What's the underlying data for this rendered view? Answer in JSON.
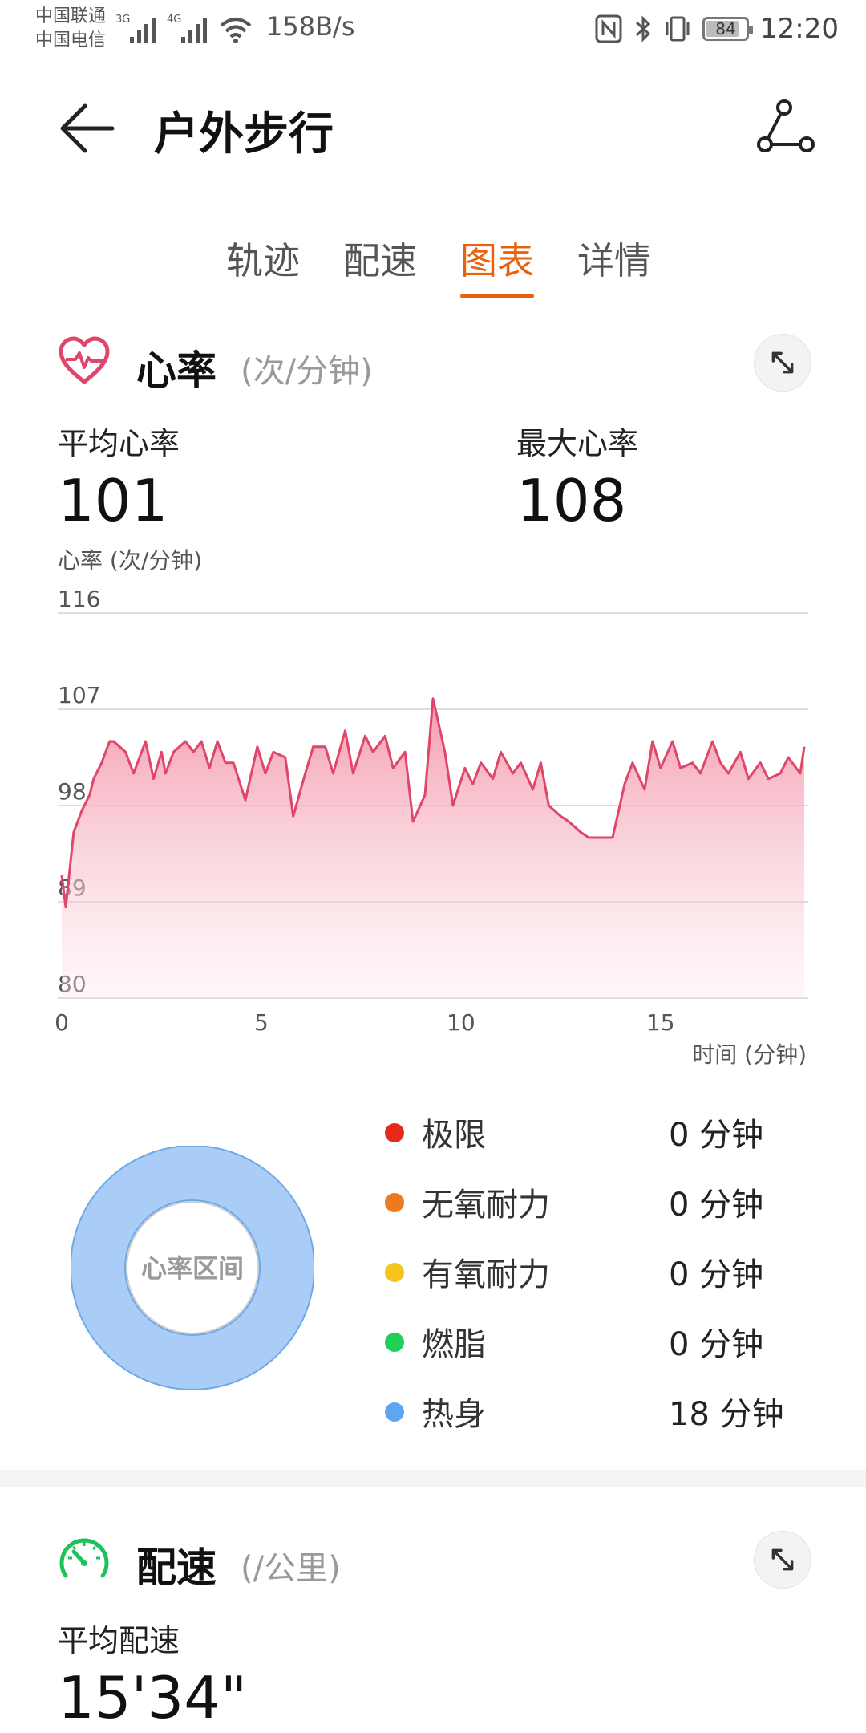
{
  "status_bar": {
    "carrier1": "中国联通",
    "carrier2": "中国电信",
    "sig1_tag": "3G",
    "sig2_tag": "4G",
    "net_speed": "158B/s",
    "battery": "84",
    "battery_level": 0.84,
    "time": "12:20"
  },
  "header": {
    "title": "户外步行"
  },
  "tabs": [
    {
      "label": "轨迹"
    },
    {
      "label": "配速"
    },
    {
      "label": "图表",
      "active": true
    },
    {
      "label": "详情"
    }
  ],
  "heart_rate": {
    "title": "心率",
    "unit": "(次/分钟)",
    "avg_label": "平均心率",
    "avg_value": "101",
    "max_label": "最大心率",
    "max_value": "108"
  },
  "chart_data": {
    "type": "area",
    "ylabel": "心率 (次/分钟)",
    "xlabel": "时间 (分钟)",
    "ylim": [
      80,
      116
    ],
    "yticks": [
      "116",
      "107",
      "98",
      "89",
      "80"
    ],
    "xlim": [
      -0.1,
      18.7
    ],
    "xticks": [
      "0",
      "5",
      "10",
      "15"
    ],
    "xtick_values": [
      0,
      5,
      10,
      15
    ],
    "color": "#e0466a",
    "x": [
      0,
      0.1,
      0.3,
      0.5,
      0.7,
      0.8,
      1.0,
      1.2,
      1.3,
      1.6,
      1.8,
      2.1,
      2.3,
      2.5,
      2.6,
      2.8,
      3.1,
      3.3,
      3.5,
      3.7,
      3.9,
      4.1,
      4.3,
      4.6,
      4.9,
      5.1,
      5.3,
      5.6,
      5.8,
      6.1,
      6.3,
      6.6,
      6.8,
      7.1,
      7.3,
      7.6,
      7.8,
      8.1,
      8.3,
      8.6,
      8.8,
      9.1,
      9.3,
      9.6,
      9.8,
      10.1,
      10.3,
      10.5,
      10.8,
      11.0,
      11.3,
      11.5,
      11.8,
      12.0,
      12.2,
      12.5,
      12.7,
      13.0,
      13.2,
      13.4,
      13.6,
      13.8,
      14.1,
      14.3,
      14.6,
      14.8,
      15.0,
      15.3,
      15.5,
      15.8,
      16.0,
      16.3,
      16.5,
      16.7,
      17.0,
      17.2,
      17.5,
      17.7,
      18.0,
      18.2,
      18.5,
      18.6
    ],
    "y": [
      91.5,
      88.5,
      95.5,
      97.5,
      99.0,
      100.5,
      102.0,
      104.0,
      104.0,
      103.0,
      101.0,
      104.0,
      100.5,
      103.0,
      101.0,
      103.0,
      104.0,
      103.0,
      104.0,
      101.5,
      104.0,
      102.0,
      102.0,
      98.5,
      103.5,
      101.0,
      103.0,
      102.5,
      97.0,
      101.0,
      103.5,
      103.5,
      101.0,
      105.0,
      101.0,
      104.5,
      103.0,
      104.5,
      101.5,
      103.0,
      96.5,
      99.0,
      108.0,
      103.0,
      98.0,
      101.5,
      100.0,
      102.0,
      100.5,
      103.0,
      101.0,
      102.0,
      99.5,
      102.0,
      98.0,
      97.0,
      96.5,
      95.5,
      95.0,
      95.0,
      95.0,
      95.0,
      100.0,
      102.0,
      99.5,
      104.0,
      101.5,
      104.0,
      101.5,
      102.0,
      101.0,
      104.0,
      102.0,
      101.0,
      103.0,
      100.5,
      102.0,
      100.5,
      101.0,
      102.5,
      101.0,
      103.5
    ],
    "grid": true
  },
  "zones": {
    "center_label": "心率区间",
    "items": [
      {
        "name": "极限",
        "value": "0 分钟",
        "color": "#e52a1c",
        "minutes": 0
      },
      {
        "name": "无氧耐力",
        "value": "0 分钟",
        "color": "#ee7a1e",
        "minutes": 0
      },
      {
        "name": "有氧耐力",
        "value": "0 分钟",
        "color": "#f3c51e",
        "minutes": 0
      },
      {
        "name": "燃脂",
        "value": "0 分钟",
        "color": "#1fcf5a",
        "minutes": 0
      },
      {
        "name": "热身",
        "value": "18 分钟",
        "color": "#5ea6f2",
        "minutes": 18
      }
    ]
  },
  "pace": {
    "title": "配速",
    "unit": "(/公里)",
    "avg_label": "平均配速",
    "avg_value": "15'34\""
  },
  "colors": {
    "accent": "#e8620f",
    "heart": "#e0466a",
    "pace": "#1ec25a",
    "donut": "#a9cdf7",
    "donut_stroke": "#6fa8e6"
  }
}
